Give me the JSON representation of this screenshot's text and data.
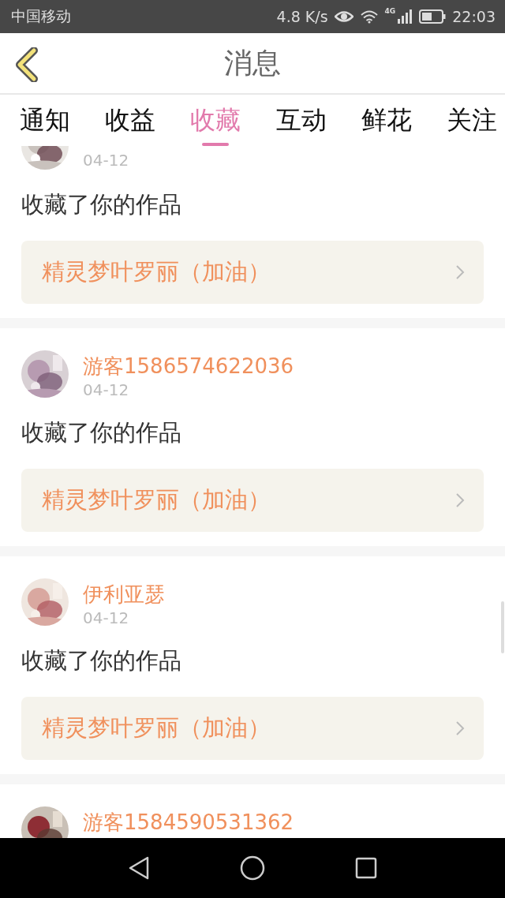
{
  "status_bar": {
    "carrier": "中国移动",
    "speed": "4.8 K/s",
    "network": "4G",
    "time": "22:03"
  },
  "header": {
    "title": "消息"
  },
  "tabs": [
    {
      "label": "通知",
      "selected": false
    },
    {
      "label": "收益",
      "selected": false
    },
    {
      "label": "收藏",
      "selected": true
    },
    {
      "label": "互动",
      "selected": false
    },
    {
      "label": "鲜花",
      "selected": false
    },
    {
      "label": "关注",
      "selected": false
    }
  ],
  "messages": [
    {
      "date": "04-12",
      "text": "收藏了你的作品",
      "work": "精灵梦叶罗丽（加油）"
    },
    {
      "name": "游客1586574622036",
      "date": "04-12",
      "text": "收藏了你的作品",
      "work": "精灵梦叶罗丽（加油）"
    },
    {
      "name": "伊利亚瑟",
      "date": "04-12",
      "text": "收藏了你的作品",
      "work": "精灵梦叶罗丽（加油）"
    },
    {
      "name": "游客1584590531362"
    }
  ]
}
